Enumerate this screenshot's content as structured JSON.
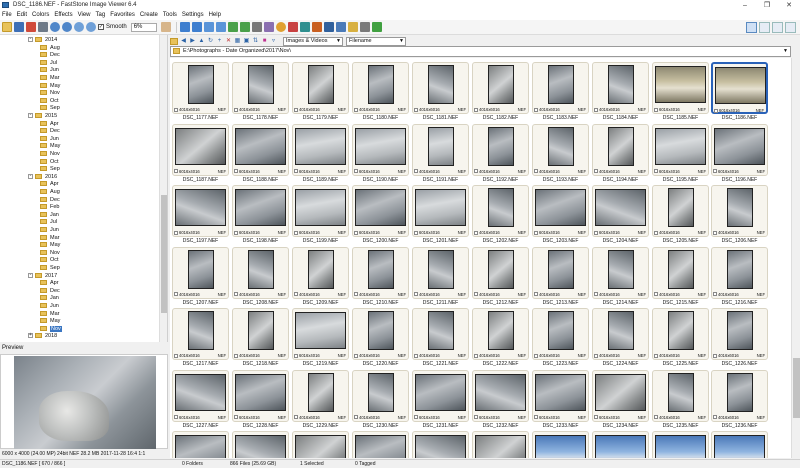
{
  "window": {
    "title": "DSC_1186.NEF - FastStone Image Viewer 6.4"
  },
  "menu": [
    "File",
    "Edit",
    "Colors",
    "Effects",
    "View",
    "Tag",
    "Favorites",
    "Create",
    "Tools",
    "Settings",
    "Help"
  ],
  "toolbar": {
    "smooth_label": "Smooth",
    "zoom": "6%"
  },
  "tree": [
    {
      "label": "2014",
      "level": 0,
      "expander": "-"
    },
    {
      "label": "Aug",
      "level": 1
    },
    {
      "label": "Dec",
      "level": 1
    },
    {
      "label": "Jul",
      "level": 1
    },
    {
      "label": "Jun",
      "level": 1
    },
    {
      "label": "Mar",
      "level": 1
    },
    {
      "label": "May",
      "level": 1
    },
    {
      "label": "Nov",
      "level": 1
    },
    {
      "label": "Oct",
      "level": 1
    },
    {
      "label": "Sep",
      "level": 1
    },
    {
      "label": "2015",
      "level": 0,
      "expander": "-"
    },
    {
      "label": "Apr",
      "level": 1
    },
    {
      "label": "Dec",
      "level": 1
    },
    {
      "label": "Jun",
      "level": 1
    },
    {
      "label": "May",
      "level": 1
    },
    {
      "label": "Nov",
      "level": 1
    },
    {
      "label": "Oct",
      "level": 1
    },
    {
      "label": "Sep",
      "level": 1
    },
    {
      "label": "2016",
      "level": 0,
      "expander": "-"
    },
    {
      "label": "Apr",
      "level": 1
    },
    {
      "label": "Aug",
      "level": 1
    },
    {
      "label": "Dec",
      "level": 1
    },
    {
      "label": "Feb",
      "level": 1
    },
    {
      "label": "Jan",
      "level": 1
    },
    {
      "label": "Jul",
      "level": 1
    },
    {
      "label": "Jun",
      "level": 1
    },
    {
      "label": "Mar",
      "level": 1
    },
    {
      "label": "May",
      "level": 1
    },
    {
      "label": "Nov",
      "level": 1
    },
    {
      "label": "Oct",
      "level": 1
    },
    {
      "label": "Sep",
      "level": 1
    },
    {
      "label": "2017",
      "level": 0,
      "expander": "-"
    },
    {
      "label": "Apr",
      "level": 1
    },
    {
      "label": "Dec",
      "level": 1
    },
    {
      "label": "Jan",
      "level": 1
    },
    {
      "label": "Jun",
      "level": 1
    },
    {
      "label": "Mar",
      "level": 1
    },
    {
      "label": "May",
      "level": 1
    },
    {
      "label": "Nov",
      "level": 1,
      "selected": true
    },
    {
      "label": "2018",
      "level": 0,
      "expander": "+"
    }
  ],
  "preview": {
    "label": "Preview",
    "info": "6000 x 4000 (24.00 MP)  24bit  NEF   28.2 MB   2017-11-28 16:4  1:1"
  },
  "filter": {
    "type": "Images & Videos",
    "sort": "Filename"
  },
  "path": "E:\\Photographs - Date Organized\\2017\\Nov\\",
  "thumbnails": [
    {
      "name": "DSC_1177.NEF",
      "res": "4016x6016",
      "orient": "port",
      "tone": "a"
    },
    {
      "name": "DSC_1178.NEF",
      "res": "4016x6016",
      "orient": "port",
      "tone": "b"
    },
    {
      "name": "DSC_1179.NEF",
      "res": "4016x6016",
      "orient": "port",
      "tone": "c"
    },
    {
      "name": "DSC_1180.NEF",
      "res": "4016x6016",
      "orient": "port",
      "tone": "a"
    },
    {
      "name": "DSC_1181.NEF",
      "res": "4016x6016",
      "orient": "port",
      "tone": "b"
    },
    {
      "name": "DSC_1182.NEF",
      "res": "4016x6016",
      "orient": "port",
      "tone": "c"
    },
    {
      "name": "DSC_1183.NEF",
      "res": "4016x6016",
      "orient": "port",
      "tone": "a"
    },
    {
      "name": "DSC_1184.NEF",
      "res": "4016x6016",
      "orient": "port",
      "tone": "b"
    },
    {
      "name": "DSC_1185.NEF",
      "res": "6016x4016",
      "orient": "land",
      "tone": "d"
    },
    {
      "name": "DSC_1186.NEF",
      "res": "6016x4016",
      "orient": "land",
      "tone": "d",
      "selected": true
    },
    {
      "name": "DSC_1187.NEF",
      "res": "6016x4016",
      "orient": "land",
      "tone": "c"
    },
    {
      "name": "DSC_1188.NEF",
      "res": "6016x4016",
      "orient": "land",
      "tone": "a"
    },
    {
      "name": "DSC_1189.NEF",
      "res": "6016x4016",
      "orient": "land",
      "tone": "e"
    },
    {
      "name": "DSC_1190.NEF",
      "res": "6016x4016",
      "orient": "land",
      "tone": "e"
    },
    {
      "name": "DSC_1191.NEF",
      "res": "4016x6016",
      "orient": "port",
      "tone": "e"
    },
    {
      "name": "DSC_1192.NEF",
      "res": "4016x6016",
      "orient": "port",
      "tone": "a"
    },
    {
      "name": "DSC_1193.NEF",
      "res": "4016x6016",
      "orient": "port",
      "tone": "b"
    },
    {
      "name": "DSC_1194.NEF",
      "res": "4016x6016",
      "orient": "port",
      "tone": "c"
    },
    {
      "name": "DSC_1195.NEF",
      "res": "6016x4016",
      "orient": "land",
      "tone": "e"
    },
    {
      "name": "DSC_1196.NEF",
      "res": "6016x4016",
      "orient": "land",
      "tone": "a"
    },
    {
      "name": "DSC_1197.NEF",
      "res": "6016x4016",
      "orient": "land",
      "tone": "b"
    },
    {
      "name": "DSC_1198.NEF",
      "res": "6016x4016",
      "orient": "land",
      "tone": "a"
    },
    {
      "name": "DSC_1199.NEF",
      "res": "6016x4016",
      "orient": "land",
      "tone": "e"
    },
    {
      "name": "DSC_1200.NEF",
      "res": "6016x4016",
      "orient": "land",
      "tone": "a"
    },
    {
      "name": "DSC_1201.NEF",
      "res": "6016x4016",
      "orient": "land",
      "tone": "e"
    },
    {
      "name": "DSC_1202.NEF",
      "res": "4016x6016",
      "orient": "port",
      "tone": "b"
    },
    {
      "name": "DSC_1203.NEF",
      "res": "6016x4016",
      "orient": "land",
      "tone": "a"
    },
    {
      "name": "DSC_1204.NEF",
      "res": "6016x4016",
      "orient": "land",
      "tone": "b"
    },
    {
      "name": "DSC_1205.NEF",
      "res": "4016x6016",
      "orient": "port",
      "tone": "c"
    },
    {
      "name": "DSC_1206.NEF",
      "res": "4016x6016",
      "orient": "port",
      "tone": "b"
    },
    {
      "name": "DSC_1207.NEF",
      "res": "4016x6016",
      "orient": "port",
      "tone": "a"
    },
    {
      "name": "DSC_1208.NEF",
      "res": "4016x6016",
      "orient": "port",
      "tone": "b"
    },
    {
      "name": "DSC_1209.NEF",
      "res": "4016x6016",
      "orient": "port",
      "tone": "c"
    },
    {
      "name": "DSC_1210.NEF",
      "res": "4016x6016",
      "orient": "port",
      "tone": "a"
    },
    {
      "name": "DSC_1211.NEF",
      "res": "4016x6016",
      "orient": "port",
      "tone": "b"
    },
    {
      "name": "DSC_1212.NEF",
      "res": "4016x6016",
      "orient": "port",
      "tone": "c"
    },
    {
      "name": "DSC_1213.NEF",
      "res": "4016x6016",
      "orient": "port",
      "tone": "a"
    },
    {
      "name": "DSC_1214.NEF",
      "res": "4016x6016",
      "orient": "port",
      "tone": "b"
    },
    {
      "name": "DSC_1215.NEF",
      "res": "4016x6016",
      "orient": "port",
      "tone": "c"
    },
    {
      "name": "DSC_1216.NEF",
      "res": "4016x6016",
      "orient": "port",
      "tone": "a"
    },
    {
      "name": "DSC_1217.NEF",
      "res": "4016x6016",
      "orient": "port",
      "tone": "b"
    },
    {
      "name": "DSC_1218.NEF",
      "res": "4016x6016",
      "orient": "port",
      "tone": "c"
    },
    {
      "name": "DSC_1219.NEF",
      "res": "6016x4016",
      "orient": "land",
      "tone": "e"
    },
    {
      "name": "DSC_1220.NEF",
      "res": "4016x6016",
      "orient": "port",
      "tone": "a"
    },
    {
      "name": "DSC_1221.NEF",
      "res": "4016x6016",
      "orient": "port",
      "tone": "b"
    },
    {
      "name": "DSC_1222.NEF",
      "res": "4016x6016",
      "orient": "port",
      "tone": "c"
    },
    {
      "name": "DSC_1223.NEF",
      "res": "4016x6016",
      "orient": "port",
      "tone": "a"
    },
    {
      "name": "DSC_1224.NEF",
      "res": "4016x6016",
      "orient": "port",
      "tone": "b"
    },
    {
      "name": "DSC_1225.NEF",
      "res": "4016x6016",
      "orient": "port",
      "tone": "c"
    },
    {
      "name": "DSC_1226.NEF",
      "res": "4016x6016",
      "orient": "port",
      "tone": "a"
    },
    {
      "name": "DSC_1227.NEF",
      "res": "6016x4016",
      "orient": "land",
      "tone": "b"
    },
    {
      "name": "DSC_1228.NEF",
      "res": "6016x4016",
      "orient": "land",
      "tone": "a"
    },
    {
      "name": "DSC_1229.NEF",
      "res": "4016x6016",
      "orient": "port",
      "tone": "c"
    },
    {
      "name": "DSC_1230.NEF",
      "res": "4016x6016",
      "orient": "port",
      "tone": "b"
    },
    {
      "name": "DSC_1231.NEF",
      "res": "6016x4016",
      "orient": "land",
      "tone": "a"
    },
    {
      "name": "DSC_1232.NEF",
      "res": "6016x4016",
      "orient": "land",
      "tone": "b"
    },
    {
      "name": "DSC_1233.NEF",
      "res": "6016x4016",
      "orient": "land",
      "tone": "a"
    },
    {
      "name": "DSC_1234.NEF",
      "res": "6016x4016",
      "orient": "land",
      "tone": "c"
    },
    {
      "name": "DSC_1235.NEF",
      "res": "4016x6016",
      "orient": "port",
      "tone": "b"
    },
    {
      "name": "DSC_1236.NEF",
      "res": "4016x6016",
      "orient": "port",
      "tone": "a"
    },
    {
      "name": "",
      "res": "",
      "orient": "land",
      "tone": "a"
    },
    {
      "name": "",
      "res": "",
      "orient": "land",
      "tone": "b"
    },
    {
      "name": "",
      "res": "",
      "orient": "land",
      "tone": "c"
    },
    {
      "name": "",
      "res": "",
      "orient": "land",
      "tone": "a"
    },
    {
      "name": "",
      "res": "",
      "orient": "land",
      "tone": "b"
    },
    {
      "name": "",
      "res": "",
      "orient": "land",
      "tone": "c"
    },
    {
      "name": "",
      "res": "",
      "orient": "land",
      "tone": "f"
    },
    {
      "name": "",
      "res": "",
      "orient": "land",
      "tone": "f"
    },
    {
      "name": "",
      "res": "",
      "orient": "land",
      "tone": "f"
    },
    {
      "name": "",
      "res": "",
      "orient": "land",
      "tone": "f"
    }
  ],
  "thumb_ext": "NEF",
  "status": {
    "file": "DSC_1186.NEF [ 670 / 866 ]",
    "folders": "0 Folders",
    "files": "866 Files (25.69 GB)",
    "selected": "1 Selected",
    "tagged": "0 Tagged"
  },
  "colors": {
    "selection": "#2a62b8",
    "card_bg": "#f7f5ee",
    "tree_select": "#3a76c2"
  }
}
